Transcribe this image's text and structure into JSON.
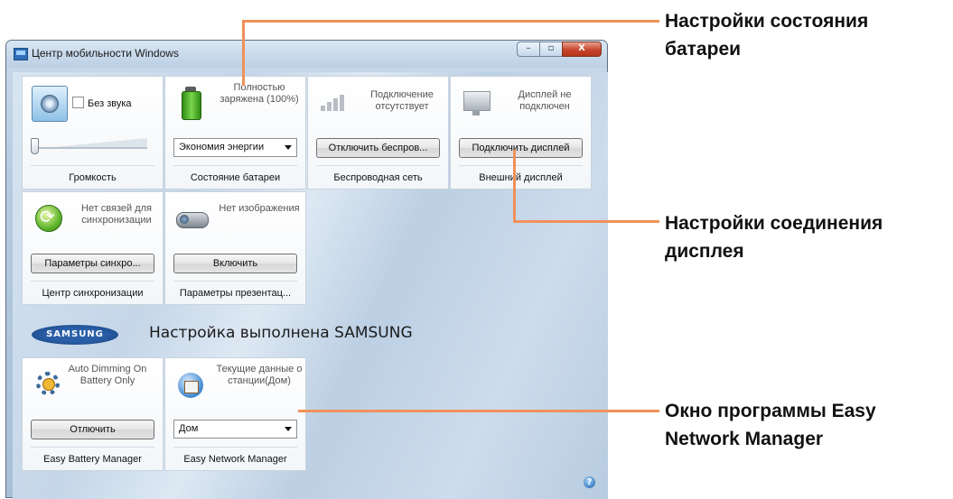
{
  "window": {
    "title": "Центр мобильности Windows",
    "buttons": {
      "minimize": "–",
      "maximize": "▫",
      "close": "X"
    }
  },
  "tiles": {
    "volume": {
      "mute_label": "Без звука",
      "caption": "Громкость"
    },
    "battery": {
      "status": "Полностью заряжена (100%)",
      "plan_selected": "Экономия энергии",
      "caption": "Состояние батареи"
    },
    "wireless": {
      "status": "Подключение отсутствует",
      "button": "Отключить беспров...",
      "caption": "Беспроводная сеть"
    },
    "display": {
      "status": "Дисплей не подключен",
      "button": "Подключить дисплей",
      "caption": "Внешний дисплей"
    },
    "sync": {
      "status": "Нет связей для синхронизации",
      "button": "Параметры синхро...",
      "caption": "Центр синхронизации"
    },
    "presentation": {
      "status": "Нет изображения",
      "button": "Включить",
      "caption": "Параметры презентац..."
    },
    "easy_battery": {
      "status": "Auto Dimming On Battery Only",
      "button": "Отлючить",
      "caption": "Easy Battery Manager"
    },
    "easy_network": {
      "status": "Текущие данные о станции(Дом)",
      "location_selected": "Дом",
      "caption": "Easy Network Manager"
    }
  },
  "samsung": {
    "logo": "SAMSUNG",
    "caption": "Настройка выполнена SAMSUNG"
  },
  "help": "?",
  "callouts": {
    "battery": "Настройки состояния батареи",
    "display": "Настройки соединения дисплея",
    "network": "Окно программы Easy Network Manager"
  }
}
